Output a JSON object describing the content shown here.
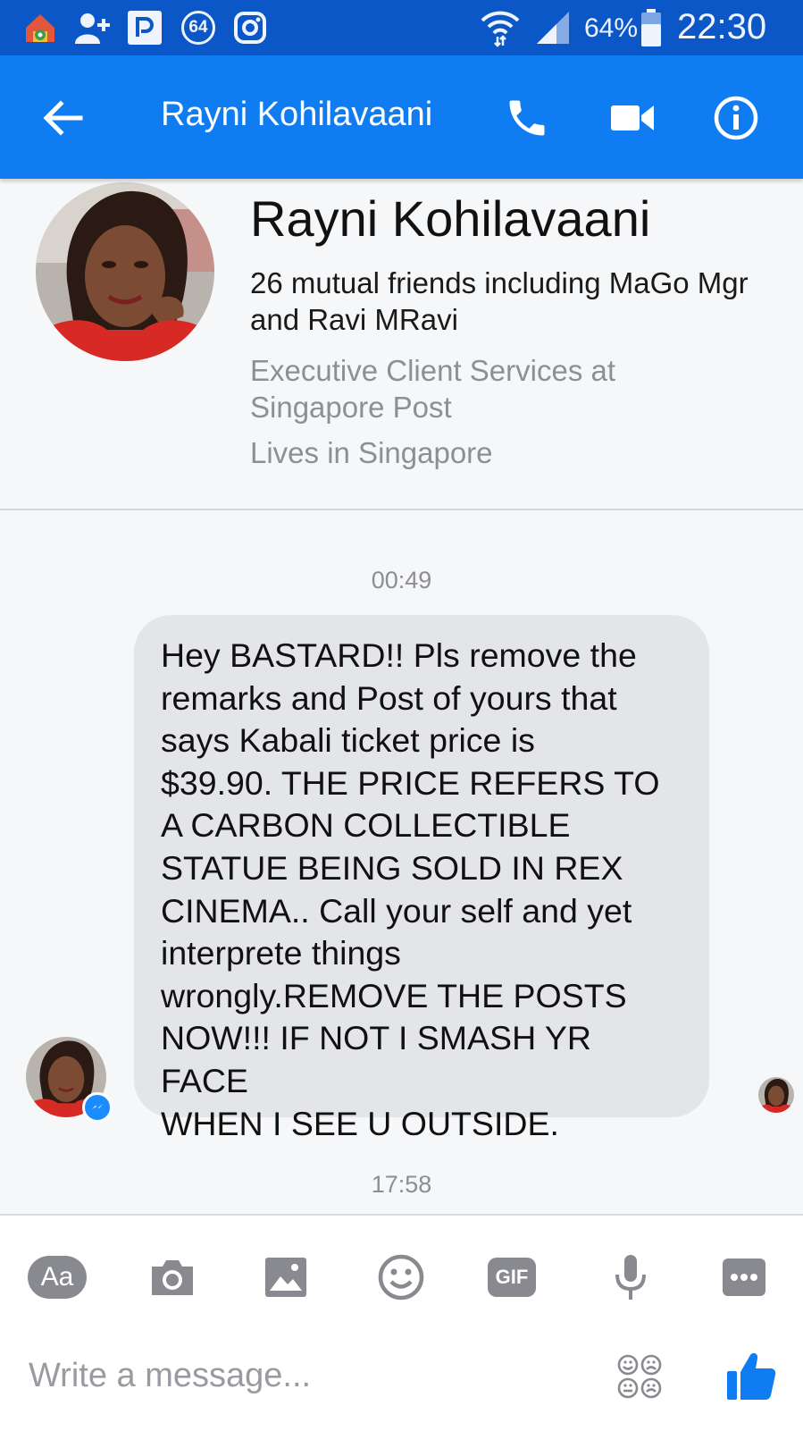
{
  "status_bar": {
    "notification_count": "64",
    "battery": "64%",
    "time": "22:30"
  },
  "app_bar": {
    "title": "Rayni Kohilavaani",
    "back_icon": "arrow-left-icon",
    "call_icon": "phone-icon",
    "video_icon": "video-camera-icon",
    "info_icon": "info-icon"
  },
  "profile": {
    "name": "Rayni Kohilavaani",
    "mutual_friends": "26 mutual friends including MaGo Mgr and Ravi MRavi",
    "job": "Executive Client Services at Singapore Post",
    "lives": "Lives in Singapore"
  },
  "conversation": {
    "messages": [
      {
        "timestamp": "00:49",
        "text": "Hey BASTARD!! Pls remove the\nremarks and Post of yours that\nsays Kabali ticket price is\n$39.90. THE PRICE REFERS TO\nA CARBON COLLECTIBLE\nSTATUE BEING SOLD IN REX\nCINEMA.. Call your self and yet\ninterprete things\nwrongly.REMOVE THE POSTS\nNOW!!! IF NOT I SMASH YR FACE\nWHEN I SEE U OUTSIDE."
      }
    ],
    "next_timestamp": "17:58"
  },
  "composer": {
    "tools": [
      {
        "name": "text-format-button",
        "label": "Aa"
      },
      {
        "name": "camera-button",
        "icon": "camera-icon"
      },
      {
        "name": "gallery-button",
        "icon": "image-icon"
      },
      {
        "name": "emoji-button",
        "icon": "smiley-icon"
      },
      {
        "name": "gif-button",
        "label": "GIF"
      },
      {
        "name": "microphone-button",
        "icon": "microphone-icon"
      },
      {
        "name": "more-button",
        "icon": "more-icon"
      }
    ],
    "placeholder": "Write a message...",
    "sticker_icon": "sticker-faces-icon",
    "like_icon": "thumbs-up-icon"
  },
  "colors": {
    "status_bar": "#0b57c8",
    "app_bar": "#0f7cf1",
    "bubble": "#e4e5e9",
    "like": "#0f7cf1",
    "tool_icon": "#888a8f"
  }
}
